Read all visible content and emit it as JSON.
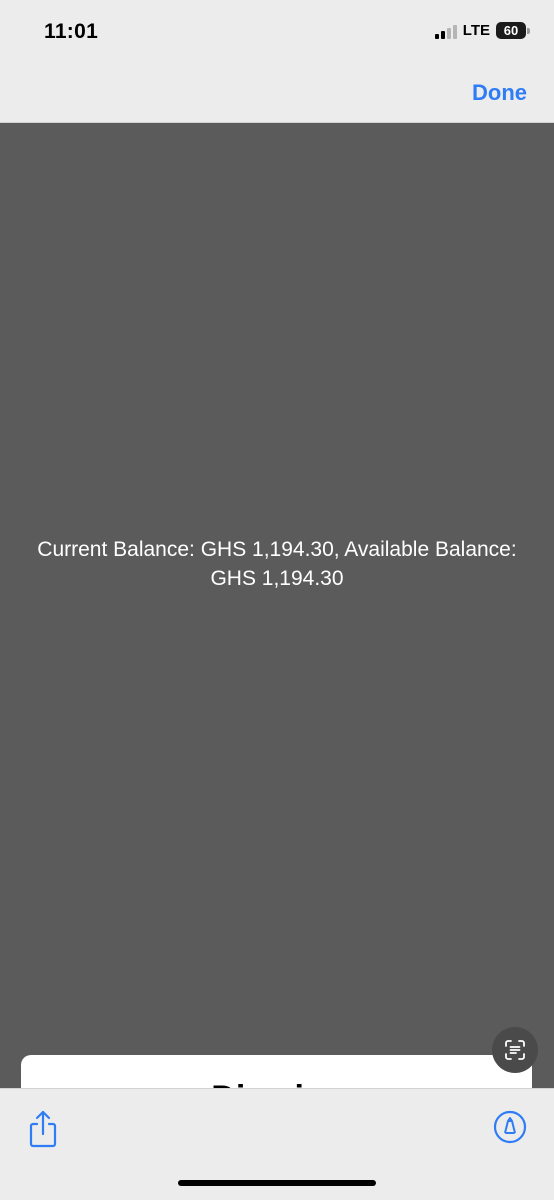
{
  "status_bar": {
    "time": "11:01",
    "network": "LTE",
    "battery": "60"
  },
  "nav": {
    "done_label": "Done"
  },
  "content": {
    "text": "Current Balance: GHS 1,194.30, Available Balance: GHS 1,194.30"
  },
  "sheet": {
    "title_partial": "Dismiss"
  },
  "colors": {
    "accent": "#2f7df6",
    "bar_background": "#ececec",
    "content_background": "#5b5b5b"
  },
  "icons": {
    "live_text": "live-text-icon",
    "share": "share-icon",
    "markup": "markup-icon"
  }
}
